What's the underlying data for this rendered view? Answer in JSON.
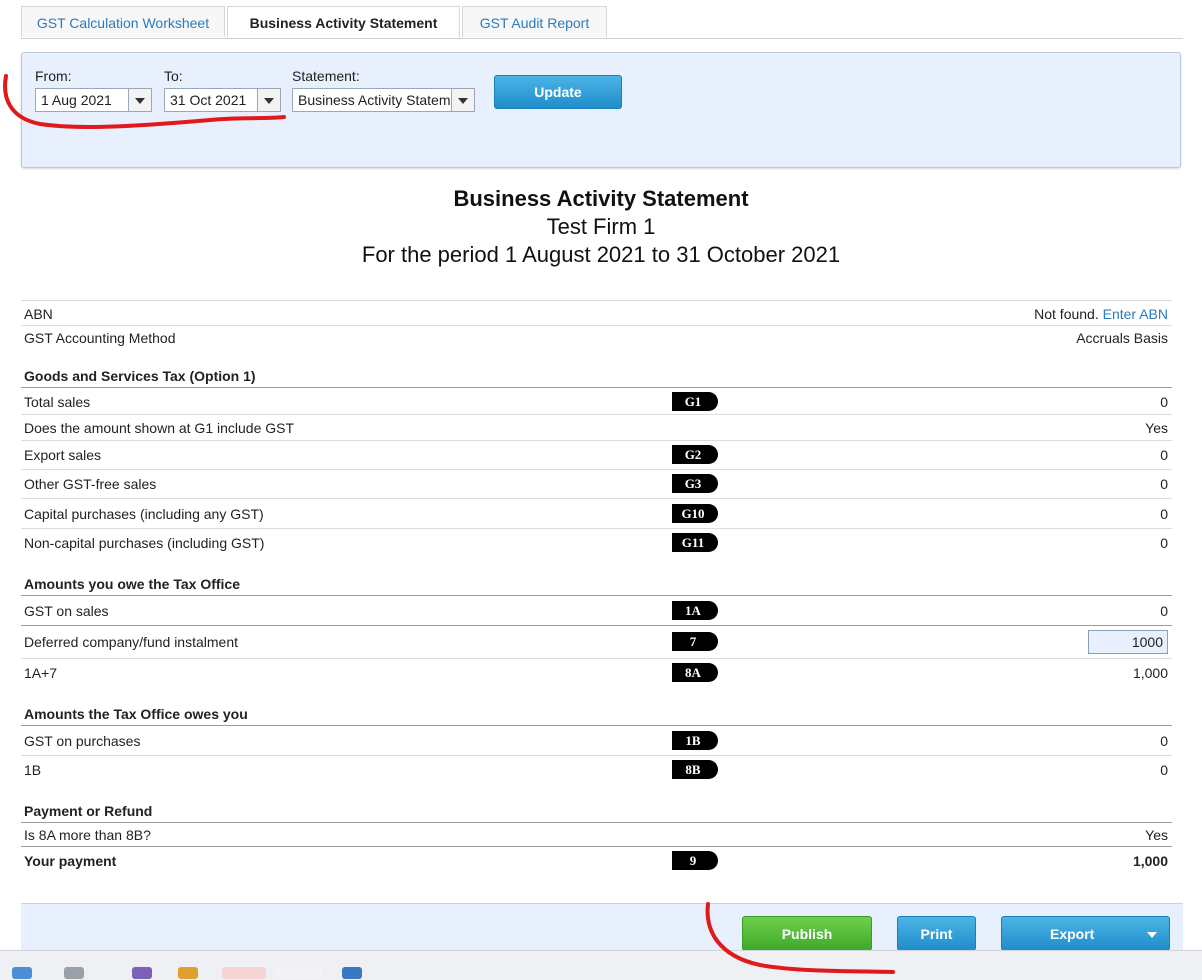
{
  "tabs": [
    {
      "label": "GST Calculation Worksheet",
      "active": false
    },
    {
      "label": "Business Activity Statement",
      "active": true
    },
    {
      "label": "GST Audit Report",
      "active": false
    }
  ],
  "filters": {
    "from_label": "From:",
    "from_value": "1 Aug 2021",
    "to_label": "To:",
    "to_value": "31 Oct 2021",
    "statement_label": "Statement:",
    "statement_value": "Business Activity Statement",
    "update_label": "Update"
  },
  "report": {
    "title": "Business Activity Statement",
    "firm": "Test Firm 1",
    "period": "For the period 1 August 2021 to 31 October 2021"
  },
  "info": {
    "abn_label": "ABN",
    "abn_value": "Not found.",
    "abn_link": "Enter ABN",
    "method_label": "GST Accounting Method",
    "method_value": "Accruals Basis"
  },
  "gst": {
    "heading": "Goods and Services Tax (Option 1)",
    "rows": [
      {
        "label": "Total sales",
        "code": "G1",
        "value": "0"
      },
      {
        "label": "Does the amount shown at G1 include GST",
        "code": "",
        "value": "Yes"
      },
      {
        "label": "Export sales",
        "code": "G2",
        "value": "0"
      },
      {
        "label": "Other GST-free sales",
        "code": "G3",
        "value": "0"
      },
      {
        "label": "Capital purchases (including any GST)",
        "code": "G10",
        "value": "0"
      },
      {
        "label": "Non-capital purchases (including GST)",
        "code": "G11",
        "value": "0"
      }
    ]
  },
  "owe": {
    "heading": "Amounts you owe the Tax Office",
    "rows": [
      {
        "label": "GST on sales",
        "code": "1A",
        "value": "0"
      },
      {
        "label": "Deferred company/fund instalment",
        "code": "7",
        "value": "1000"
      },
      {
        "label": "1A+7",
        "code": "8A",
        "value": "1,000"
      }
    ]
  },
  "owed": {
    "heading": "Amounts the Tax Office owes you",
    "rows": [
      {
        "label": "GST on purchases",
        "code": "1B",
        "value": "0"
      },
      {
        "label": "1B",
        "code": "8B",
        "value": "0"
      }
    ]
  },
  "payment": {
    "heading": "Payment or Refund",
    "question_label": "Is 8A more than 8B?",
    "question_value": "Yes",
    "total_label": "Your payment",
    "total_code": "9",
    "total_value": "1,000"
  },
  "footer": {
    "publish_label": "Publish",
    "print_label": "Print",
    "export_label": "Export"
  },
  "colors": {
    "panel_bg": "#e8f0fd",
    "blue_button": "#1f8dcb",
    "green_button": "#3ea92a",
    "annotation_red": "#e0191c",
    "link": "#2a7bbd"
  }
}
